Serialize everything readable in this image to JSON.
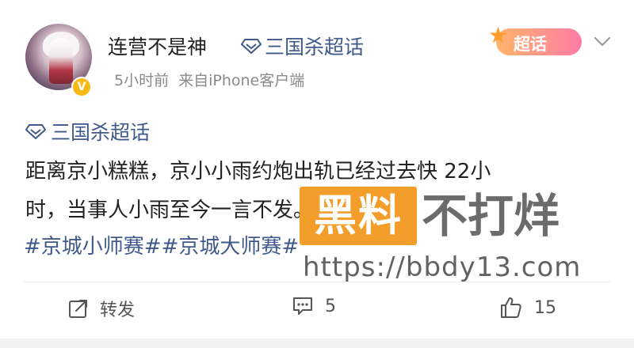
{
  "post": {
    "author": {
      "name": "连营不是神",
      "verified_badge": "V",
      "avatar_icon": "avatar-illustration"
    },
    "header_topic": "三国杀超话",
    "timestamp": "5小时前",
    "source": "来自iPhone客户端",
    "supertopic_badge": "超话",
    "topic_tag": "三国杀超话",
    "text_line1": "距离京小糕糕，京小小雨约炮出轨已经过去快 22小",
    "text_line2": "时，当事人小雨至今一言不发。",
    "hashtags": "#京城小师赛##京城大师赛#"
  },
  "watermark": {
    "box_text": "黑料",
    "text": "不打烊",
    "url": "https://bbdy13.com"
  },
  "actions": {
    "repost_label": "转发",
    "comment_count": "5",
    "like_count": "15"
  },
  "colors": {
    "link": "#3f5a8a",
    "verified": "#f8b915",
    "watermark_orange": "#f39b23"
  }
}
